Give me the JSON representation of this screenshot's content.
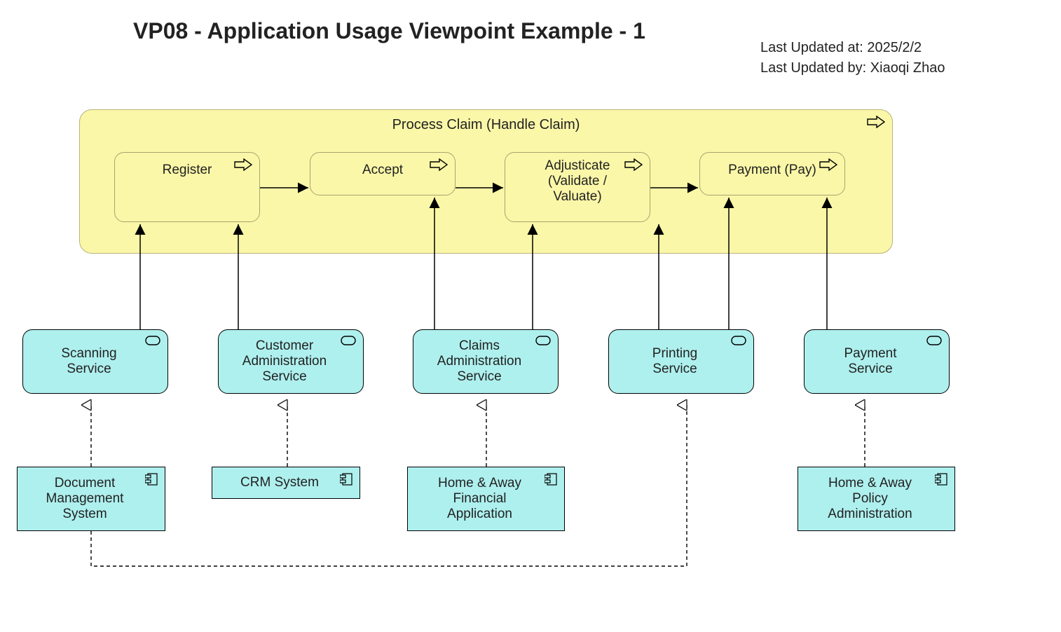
{
  "title": "VP08 - Application Usage Viewpoint Example - 1",
  "meta": {
    "updated_at_label": "Last Updated at: ",
    "updated_at": "2025/2/2",
    "updated_by_label": "Last Updated by: ",
    "updated_by": "Xiaoqi Zhao"
  },
  "process": {
    "label": "Process Claim (Handle Claim)",
    "steps": [
      {
        "label": "Register"
      },
      {
        "label": "Accept"
      },
      {
        "label": "Adjusticate\n(Validate /\nValuate)"
      },
      {
        "label": "Payment (Pay)"
      }
    ]
  },
  "services": [
    {
      "label": "Scanning\nService"
    },
    {
      "label": "Customer\nAdministration\nService"
    },
    {
      "label": "Claims\nAdministration\nService"
    },
    {
      "label": "Printing\nService"
    },
    {
      "label": "Payment\nService"
    }
  ],
  "components": [
    {
      "label": "Document\nManagement\nSystem"
    },
    {
      "label": "CRM System"
    },
    {
      "label": "Home & Away\nFinancial\nApplication"
    },
    {
      "label": "Home & Away\nPolicy\nAdministration"
    }
  ]
}
